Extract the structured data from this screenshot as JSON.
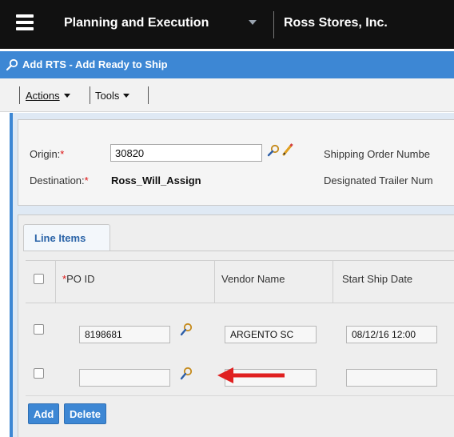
{
  "topbar": {
    "app_title": "Planning and Execution",
    "org_title": "Ross Stores, Inc."
  },
  "titlebar": {
    "title": "Add RTS - Add Ready to Ship"
  },
  "toolbar": {
    "actions_label": "Actions",
    "tools_label": "Tools"
  },
  "header": {
    "origin_label": "Origin:",
    "origin_value": "30820",
    "destination_label": "Destination:",
    "destination_value": "Ross_Will_Assign",
    "required_mark": "*",
    "shipping_order_label": "Shipping Order Numbe",
    "designated_trailer_label": "Designated Trailer Num"
  },
  "line_items": {
    "tab_label": "Line Items",
    "columns": {
      "po_id": "PO ID",
      "vendor_name": "Vendor Name",
      "start_ship_date": "Start Ship Date"
    },
    "rows": [
      {
        "po_id": "8198681",
        "vendor_name": "ARGENTO SC",
        "start_ship_date": "08/12/16 12:00"
      },
      {
        "po_id": "",
        "vendor_name": "",
        "start_ship_date": ""
      }
    ]
  },
  "buttons": {
    "add": "Add",
    "delete": "Delete"
  },
  "colors": {
    "accent_blue": "#3d87d4",
    "topbar_black": "#111111",
    "arrow_red": "#e02020",
    "required_red": "#dd1111"
  },
  "icons": [
    "menu-icon",
    "dropdown-caret-icon",
    "search-icon",
    "lookup-icon",
    "edit-pencil-icon",
    "red-arrow-icon"
  ]
}
